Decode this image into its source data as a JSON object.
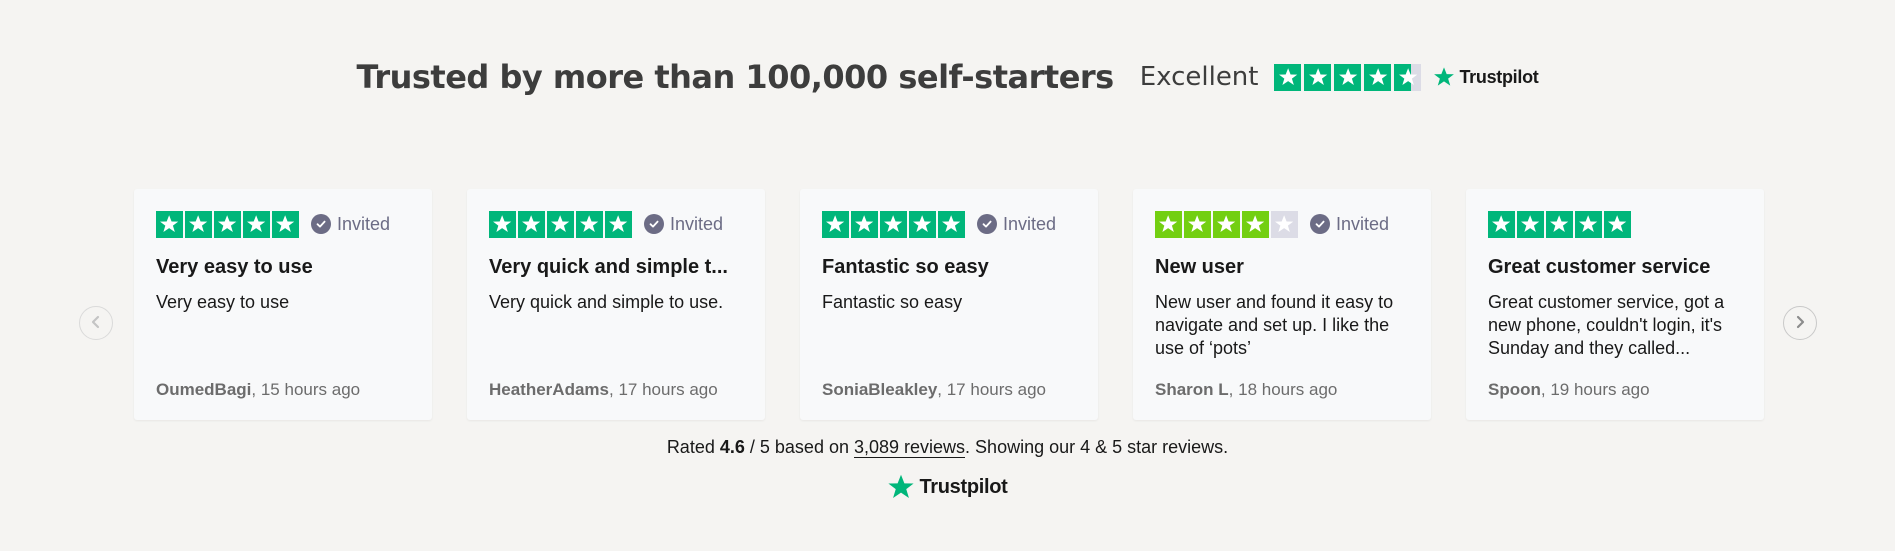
{
  "header": {
    "title": "Trusted by more than 100,000 self-starters",
    "rating_word": "Excellent",
    "stars_fraction": 4.6,
    "brand": "Trustpilot"
  },
  "colors": {
    "tp_green": "#00b67a",
    "tp_lightgreen": "#73cf11",
    "star_empty": "#dcdce6",
    "background": "#f5f4f2",
    "card_bg": "#f8f9fa",
    "invited_gray": "#6c6c85"
  },
  "icons": {
    "star": "star-icon",
    "check": "check-circle-icon",
    "prev": "chevron-left-icon",
    "next": "chevron-right-icon",
    "logo_star": "trustpilot-star-icon"
  },
  "carousel": {
    "prev_label": "",
    "next_label": "",
    "reviews": [
      {
        "stars": 5,
        "invited": "Invited",
        "title": "Very easy to use",
        "body": "Very easy to use",
        "author": "OumedBagi",
        "time": ", 15 hours ago"
      },
      {
        "stars": 5,
        "invited": "Invited",
        "title": "Very quick and simple t...",
        "body": "Very quick and simple to use.",
        "author": "HeatherAdams",
        "time": ", 17 hours ago"
      },
      {
        "stars": 5,
        "invited": "Invited",
        "title": "Fantastic so easy",
        "body": "Fantastic so easy",
        "author": "SoniaBleakley",
        "time": ", 17 hours ago"
      },
      {
        "stars": 4,
        "invited": "Invited",
        "title": "New user",
        "body": "New user and found it easy to navigate and set up. I like the use of ‘pots’",
        "author": "Sharon L",
        "time": ", 18 hours ago"
      },
      {
        "stars": 5,
        "invited": "",
        "title": "Great customer service",
        "body": "Great customer service, got a new phone, couldn't login, it's Sunday and they called...",
        "author": "Spoon",
        "time": ", 19 hours ago"
      }
    ]
  },
  "summary": {
    "prefix": "Rated ",
    "score": "4.6",
    "scale": " / 5 based on ",
    "reviews_link": "3,089 reviews",
    "suffix": ". Showing our 4 & 5 star reviews."
  },
  "footer": {
    "brand": "Trustpilot"
  }
}
